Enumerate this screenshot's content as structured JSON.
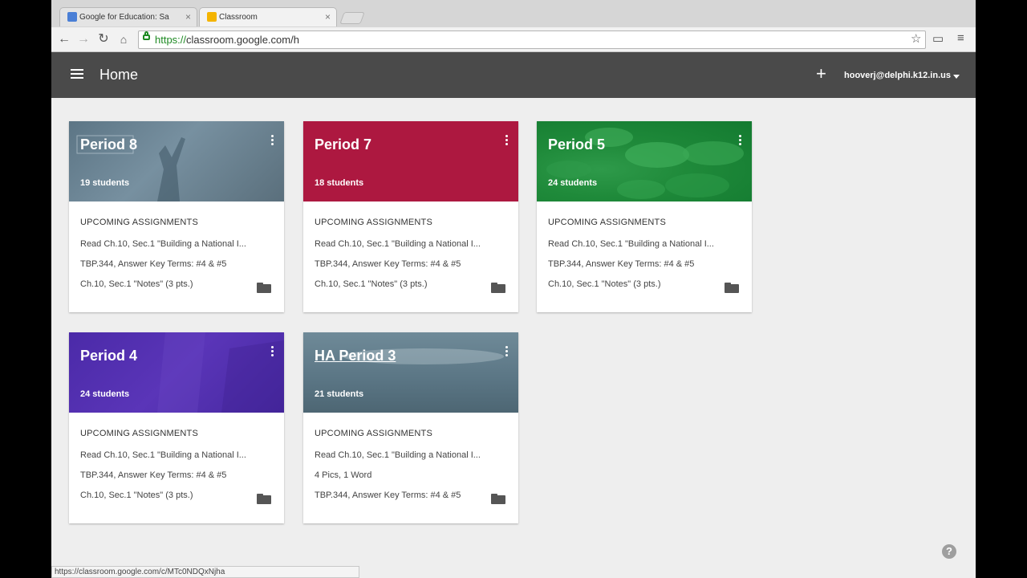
{
  "browser": {
    "tabs": [
      {
        "title": "Google for Education: Sa",
        "favicon_color": "#4a7fd6"
      },
      {
        "title": "Classroom",
        "favicon_color": "#f4b400"
      }
    ],
    "url_scheme": "https://",
    "url_rest": "classroom.google.com/h",
    "status_url": "https://classroom.google.com/c/MTc0NDQxNjha"
  },
  "header": {
    "title": "Home",
    "add_label": "+",
    "account": "hooverj@delphi.k12.in.us"
  },
  "cards": [
    {
      "title": "Period 8",
      "students": "19 students",
      "upcoming_label": "UPCOMING ASSIGNMENTS",
      "items": [
        "Read Ch.10, Sec.1 \"Building a National I...",
        "TBP.344, Answer Key Terms: #4 & #5",
        "Ch.10, Sec.1 \"Notes\" (3 pts.)"
      ]
    },
    {
      "title": "Period 7",
      "students": "18 students",
      "upcoming_label": "UPCOMING ASSIGNMENTS",
      "items": [
        "Read Ch.10, Sec.1 \"Building a National I...",
        "TBP.344, Answer Key Terms: #4 & #5",
        "Ch.10, Sec.1 \"Notes\" (3 pts.)"
      ]
    },
    {
      "title": "Period 5",
      "students": "24 students",
      "upcoming_label": "UPCOMING ASSIGNMENTS",
      "items": [
        "Read Ch.10, Sec.1 \"Building a National I...",
        "TBP.344, Answer Key Terms: #4 & #5",
        "Ch.10, Sec.1 \"Notes\" (3 pts.)"
      ]
    },
    {
      "title": "Period 4",
      "students": "24 students",
      "upcoming_label": "UPCOMING ASSIGNMENTS",
      "items": [
        "Read Ch.10, Sec.1 \"Building a National I...",
        "TBP.344, Answer Key Terms: #4 & #5",
        "Ch.10, Sec.1 \"Notes\" (3 pts.)"
      ]
    },
    {
      "title": "HA Period 3",
      "students": "21 students",
      "upcoming_label": "UPCOMING ASSIGNMENTS",
      "items": [
        "Read Ch.10, Sec.1 \"Building a National I...",
        "4 Pics, 1 Word",
        "TBP.344, Answer Key Terms: #4 & #5"
      ]
    }
  ],
  "colors": {
    "header_bg": "#4a4a4a",
    "period7": "#ad1840",
    "period4": "#4b2aa8",
    "period5": "#1f8a3a"
  }
}
